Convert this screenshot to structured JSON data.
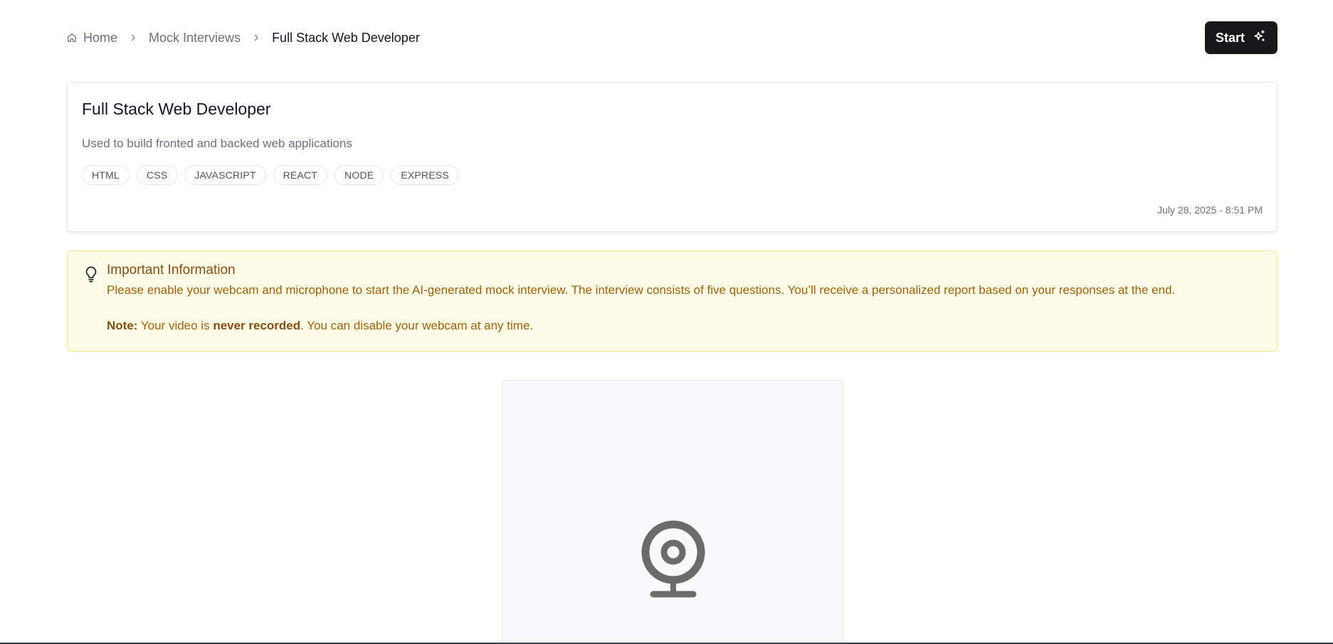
{
  "breadcrumb": {
    "items": [
      {
        "label": "Home",
        "icon": "home-icon"
      },
      {
        "label": "Mock Interviews"
      },
      {
        "label": "Full Stack Web Developer"
      }
    ],
    "separator_icon": "chevron-right-icon"
  },
  "header": {
    "start_label": "Start",
    "start_icon": "sparkles-icon"
  },
  "interview": {
    "title": "Full Stack Web Developer",
    "description": "Used to build fronted and backed web applications",
    "tags": [
      "HTML",
      "CSS",
      "JAVASCRIPT",
      "REACT",
      "NODE",
      "EXPRESS"
    ],
    "created": "July 28, 2025 - 8:51 PM"
  },
  "info": {
    "icon": "lightbulb-icon",
    "title": "Important Information",
    "body": "Please enable your webcam and microphone to start the AI-generated mock interview. The interview consists of five questions. You’ll receive a personalized report based on your responses at the end.",
    "note_label": "Note:",
    "note_pre": " Your video is ",
    "note_emphasis": "never recorded",
    "note_post": ". You can disable your webcam at any time."
  },
  "webcam": {
    "icon": "webcam-icon"
  },
  "colors": {
    "button_bg": "#18181b",
    "info_bg": "#fefce8",
    "info_border": "#fde68a",
    "info_text": "#a16207",
    "webcam_icon": "#6b6b6b"
  }
}
